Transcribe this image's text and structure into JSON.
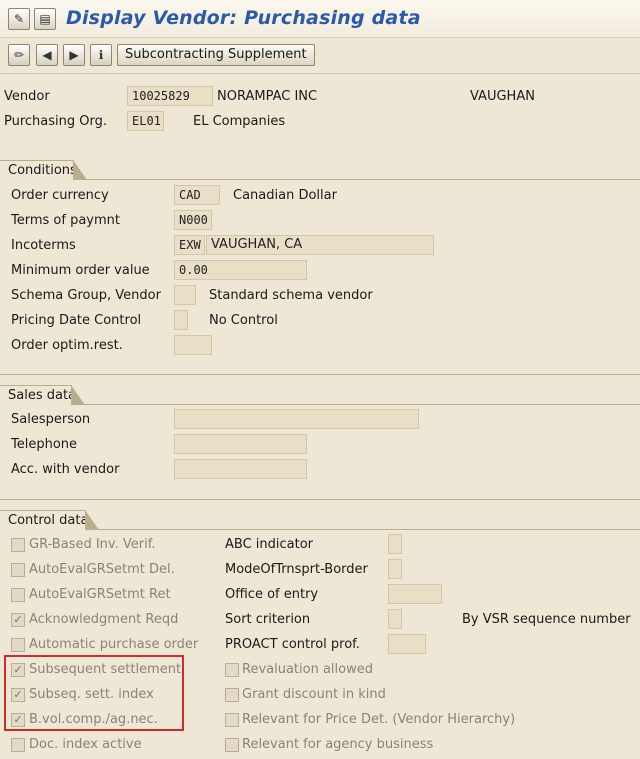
{
  "app": {
    "title": "Display Vendor: Purchasing data"
  },
  "toolbar": {
    "subcontracting_label": "Subcontracting Supplement"
  },
  "header": {
    "vendor_label": "Vendor",
    "vendor_value": "10025829",
    "vendor_name": "NORAMPAC INC",
    "vendor_city": "VAUGHAN",
    "porg_label": "Purchasing Org.",
    "porg_value": "EL01",
    "porg_name": "EL Companies"
  },
  "conditions": {
    "title": "Conditions",
    "order_currency_label": "Order currency",
    "order_currency_value": "CAD",
    "order_currency_text": "Canadian Dollar",
    "terms_label": "Terms of paymnt",
    "terms_value": "N000",
    "incoterms_label": "Incoterms",
    "incoterms_value": "EXW",
    "incoterms_text": "VAUGHAN, CA",
    "min_order_label": "Minimum order value",
    "min_order_value": "0.00",
    "schema_label": "Schema Group, Vendor",
    "schema_value": "",
    "schema_text": "Standard schema vendor",
    "pricing_label": "Pricing Date Control",
    "pricing_value": "",
    "pricing_text": "No Control",
    "optim_label": "Order optim.rest.",
    "optim_value": ""
  },
  "sales": {
    "title": "Sales data",
    "salesperson_label": "Salesperson",
    "salesperson_value": "",
    "telephone_label": "Telephone",
    "telephone_value": "",
    "acc_label": "Acc. with vendor",
    "acc_value": ""
  },
  "control": {
    "title": "Control data",
    "left_checkboxes": [
      {
        "label": "GR-Based Inv. Verif.",
        "checked": false
      },
      {
        "label": "AutoEvalGRSetmt Del.",
        "checked": false
      },
      {
        "label": "AutoEvalGRSetmt Ret",
        "checked": false
      },
      {
        "label": "Acknowledgment Reqd",
        "checked": true
      },
      {
        "label": "Automatic purchase order",
        "checked": false
      },
      {
        "label": "Subsequent settlement",
        "checked": true
      },
      {
        "label": "Subseq. sett. index",
        "checked": true
      },
      {
        "label": "B.vol.comp./ag.nec.",
        "checked": true
      },
      {
        "label": "Doc. index active",
        "checked": false
      }
    ],
    "abc_label": "ABC indicator",
    "mode_label": "ModeOfTrnsprt-Border",
    "office_label": "Office of entry",
    "sort_label": "Sort criterion",
    "sort_text": "By VSR sequence number",
    "proact_label": "PROACT control prof.",
    "right_checkboxes": [
      {
        "label": "Revaluation allowed",
        "checked": false
      },
      {
        "label": "Grant discount in kind",
        "checked": false
      },
      {
        "label": "Relevant for Price Det. (Vendor Hierarchy)",
        "checked": false
      },
      {
        "label": "Relevant for agency business",
        "checked": false
      }
    ]
  },
  "icons": {
    "check_mark": "✓"
  }
}
